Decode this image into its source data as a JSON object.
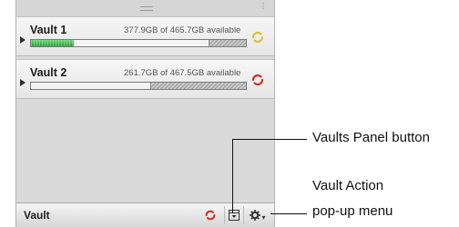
{
  "panel": {
    "vaults": [
      {
        "name": "Vault 1",
        "usage_text": "377.9GB of 465.7GB available",
        "used_fraction": 0.2,
        "status_icon": "sync-yellow-icon",
        "status_color": "#d9c23d"
      },
      {
        "name": "Vault 2",
        "usage_text": "261.7GB of 467.5GB available",
        "used_fraction": 0.0,
        "status_icon": "sync-red-icon",
        "status_color": "#c8322c"
      }
    ],
    "bottom_bar": {
      "title": "Vault",
      "sync_icon": "sync-red-icon",
      "panel_icon": "panel-icon",
      "action_icon": "gear-icon"
    }
  },
  "callouts": {
    "vaults_panel_button": "Vaults Panel button",
    "vault_action_line1": "Vault Action",
    "vault_action_line2": "pop-up menu"
  },
  "colors": {
    "fill_green": "#3fae4a",
    "accent_red": "#c8322c",
    "accent_yellow": "#d9c23d"
  }
}
